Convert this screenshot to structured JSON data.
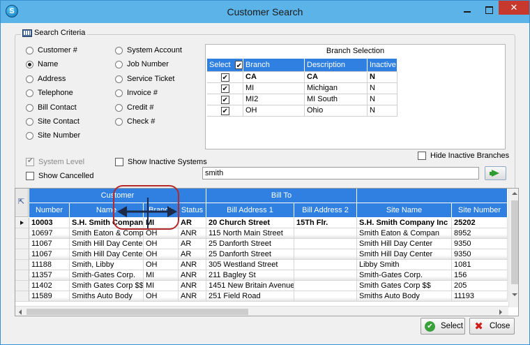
{
  "window": {
    "title": "Customer Search",
    "close_glyph": "✕",
    "app_icon_letter": "S"
  },
  "criteria": {
    "legend": "Search Criteria",
    "left_options": [
      "Customer #",
      "Name",
      "Address",
      "Telephone",
      "Bill Contact",
      "Site Contact",
      "Site Number"
    ],
    "right_options": [
      "System Account",
      "Job Number",
      "Service Ticket",
      "Invoice #",
      "Credit #",
      "Check #"
    ],
    "selected": "Name",
    "system_level": "System Level",
    "show_cancelled": "Show Cancelled",
    "show_inactive_systems": "Show Inactive Systems",
    "hide_inactive_branches": "Hide Inactive Branches"
  },
  "branch": {
    "title": "Branch Selection",
    "headers": [
      "Select",
      "Branch",
      "Description",
      "Inactive"
    ],
    "rows": [
      {
        "branch": "CA",
        "description": "CA",
        "inactive": "N"
      },
      {
        "branch": "MI",
        "description": "Michigan",
        "inactive": "N"
      },
      {
        "branch": "MI2",
        "description": "MI South",
        "inactive": "N"
      },
      {
        "branch": "OH",
        "description": "Ohio",
        "inactive": "N"
      }
    ]
  },
  "search": {
    "value": "smith"
  },
  "results": {
    "groups": [
      "Customer",
      "Bill To",
      ""
    ],
    "columns": [
      "Number",
      "Name",
      "Branch",
      "Status",
      "Bill Address 1",
      "Bill Address 2",
      "Site Name",
      "Site Number"
    ],
    "rows": [
      [
        "10003",
        "S.H. Smith Compan...",
        "MI",
        "AR",
        "20 Church Street",
        "15Th Flr.",
        "S.H. Smith Company Inc",
        "25202"
      ],
      [
        "10697",
        "Smith  Eaton & Comp",
        "OH",
        "ANR",
        "115 North Main Street",
        "",
        "Smith  Eaton & Compan",
        "8952"
      ],
      [
        "11067",
        "Smith Hill Day Center",
        "OH",
        "AR",
        "25 Danforth Street",
        "",
        "Smith Hill Day Center",
        "9350"
      ],
      [
        "11067",
        "Smith Hill Day Center",
        "OH",
        "AR",
        "25 Danforth Street",
        "",
        "Smith Hill Day Center",
        "9350"
      ],
      [
        "11188",
        "Smith, Libby",
        "OH",
        "ANR",
        "305 Westland Street",
        "",
        "Libby Smith",
        "1081"
      ],
      [
        "11357",
        "Smith-Gates Corp.",
        "MI",
        "ANR",
        "211 Bagley St",
        "",
        "Smith-Gates Corp.",
        "156"
      ],
      [
        "11402",
        "Smith Gates Corp $$",
        "MI",
        "ANR",
        "1451 New Britain Avenue",
        "",
        "Smith Gates Corp $$",
        "205"
      ],
      [
        "11589",
        "Smiths Auto Body",
        "OH",
        "ANR",
        "251 Field Road",
        "",
        "Smiths Auto Body",
        "11193"
      ]
    ]
  },
  "buttons": {
    "select": "Select",
    "close": "Close"
  }
}
